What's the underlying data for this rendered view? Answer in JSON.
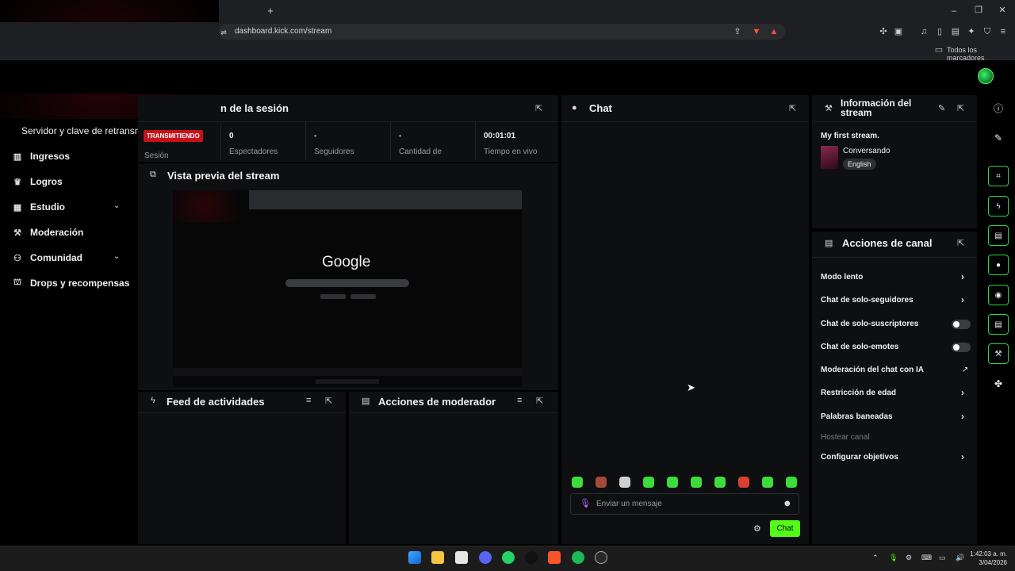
{
  "browser": {
    "new_tab": "+",
    "url": "dashboard.kick.com/stream",
    "bookmarks_label": "Todos los marcadores",
    "window_controls": [
      "minimize-icon",
      "restore-icon",
      "close-icon"
    ]
  },
  "sidebar": {
    "truncated_item": "Servidor y clave de retransn",
    "items": [
      {
        "label": "Ingresos",
        "icon": "chart-icon"
      },
      {
        "label": "Logros",
        "icon": "trophy-icon"
      },
      {
        "label": "Estudio",
        "icon": "studio-icon",
        "expandable": true
      },
      {
        "label": "Moderación",
        "icon": "wrench-icon"
      },
      {
        "label": "Comunidad",
        "icon": "people-icon",
        "expandable": true
      },
      {
        "label": "Drops y recompensas",
        "icon": "gift-icon"
      }
    ]
  },
  "session": {
    "title_partial": "n de la sesión",
    "live_badge": "TRANSMITIENDO",
    "session_label": "Sesión",
    "stats": [
      {
        "value": "0",
        "label": "Espectadores"
      },
      {
        "value": "-",
        "label": "Seguidores"
      },
      {
        "value": "-",
        "label": "Cantidad de"
      },
      {
        "value": "00:01:01",
        "label": "Tiempo en vivo"
      }
    ]
  },
  "preview": {
    "title": "Vista previa del stream",
    "google_logo": "Google"
  },
  "feed": {
    "title": "Feed de actividades"
  },
  "mod_actions": {
    "title": "Acciones de moderador"
  },
  "chat": {
    "title": "Chat",
    "placeholder": "Enviar un mensaje",
    "send_label": "Chat"
  },
  "stream_info": {
    "title": "Información del stream",
    "stream_title": "My first stream.",
    "category": "Conversando",
    "language": "English"
  },
  "channel_actions": {
    "title": "Acciones de canal",
    "items": [
      {
        "label": "Modo lento",
        "control": "arrow"
      },
      {
        "label": "Chat de solo-seguidores",
        "control": "arrow"
      },
      {
        "label": "Chat de solo-suscriptores",
        "control": "toggle",
        "on": false
      },
      {
        "label": "Chat de solo-emotes",
        "control": "toggle",
        "on": false
      },
      {
        "label": "Moderación del chat con IA",
        "control": "external"
      },
      {
        "label": "Restricción de edad",
        "control": "arrow"
      },
      {
        "label": "Palabras baneadas",
        "control": "arrow"
      },
      {
        "label": "Hostear canal",
        "control": "none",
        "disabled": true
      },
      {
        "label": "Configurar objetivos",
        "control": "arrow"
      }
    ]
  },
  "taskbar": {
    "time": "1:42:03 a. m.",
    "date": "3/04/2026"
  },
  "colors": {
    "accent": "#53fc18",
    "live_red": "#c8101a",
    "panel_bg": "#0e0f10"
  }
}
